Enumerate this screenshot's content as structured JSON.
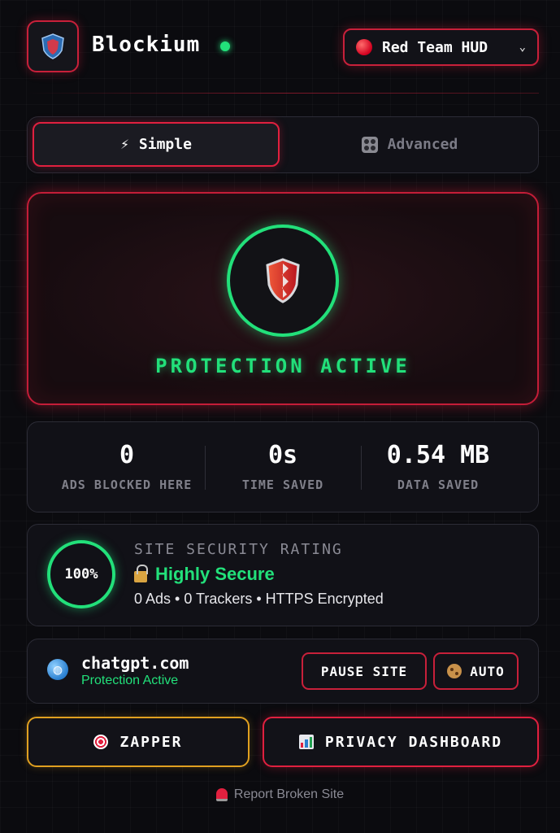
{
  "header": {
    "app_name": "Blockium",
    "mode_selector": {
      "value": "Red Team HUD",
      "icon": "red-circle-icon"
    }
  },
  "view_toggle": {
    "simple_label": "Simple",
    "simple_icon": "lightning-icon",
    "advanced_label": "Advanced",
    "advanced_icon": "dice-icon",
    "active": "simple"
  },
  "hero": {
    "status_text": "PROTECTION ACTIVE",
    "icon": "shield-icon"
  },
  "stats": [
    {
      "value": "0",
      "label": "ADS BLOCKED HERE"
    },
    {
      "value": "0s",
      "label": "TIME SAVED"
    },
    {
      "value": "0.54 MB",
      "label": "DATA SAVED"
    }
  ],
  "security": {
    "score": "100%",
    "title": "SITE SECURITY RATING",
    "grade": "Highly Secure",
    "details": "0 Ads • 0 Trackers • HTTPS Encrypted"
  },
  "site": {
    "domain": "chatgpt.com",
    "status": "Protection Active",
    "pause_label": "PAUSE SITE",
    "auto_label": "AUTO"
  },
  "actions": {
    "zapper_label": "ZAPPER",
    "dashboard_label": "PRIVACY DASHBOARD"
  },
  "footer": {
    "report_label": "Report Broken Site"
  },
  "colors": {
    "accent_red": "#e0203f",
    "accent_green": "#22e07a",
    "accent_amber": "#e0a020",
    "background": "#0b0b0f"
  }
}
